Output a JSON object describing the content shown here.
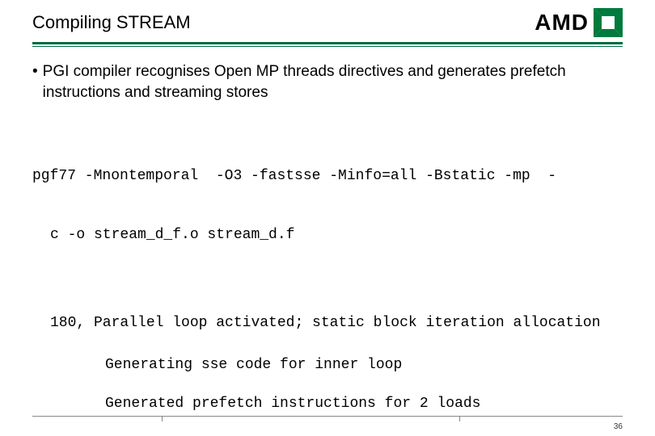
{
  "header": {
    "title": "Compiling STREAM",
    "logo_text": "AMD"
  },
  "bullet": {
    "mark": "•",
    "text": "PGI compiler recognises Open MP threads directives and generates prefetch instructions and streaming stores"
  },
  "code": {
    "line1": "pgf77 -Mnontemporal  -O3 -fastsse -Minfo=all -Bstatic -mp  -",
    "line2": "c -o stream_d_f.o stream_d.f"
  },
  "output": {
    "line1": "180, Parallel loop activated; static block iteration allocation",
    "line2": "Generating sse code for inner loop",
    "line3": "Generated prefetch instructions for 2 loads"
  },
  "page_number": "36"
}
